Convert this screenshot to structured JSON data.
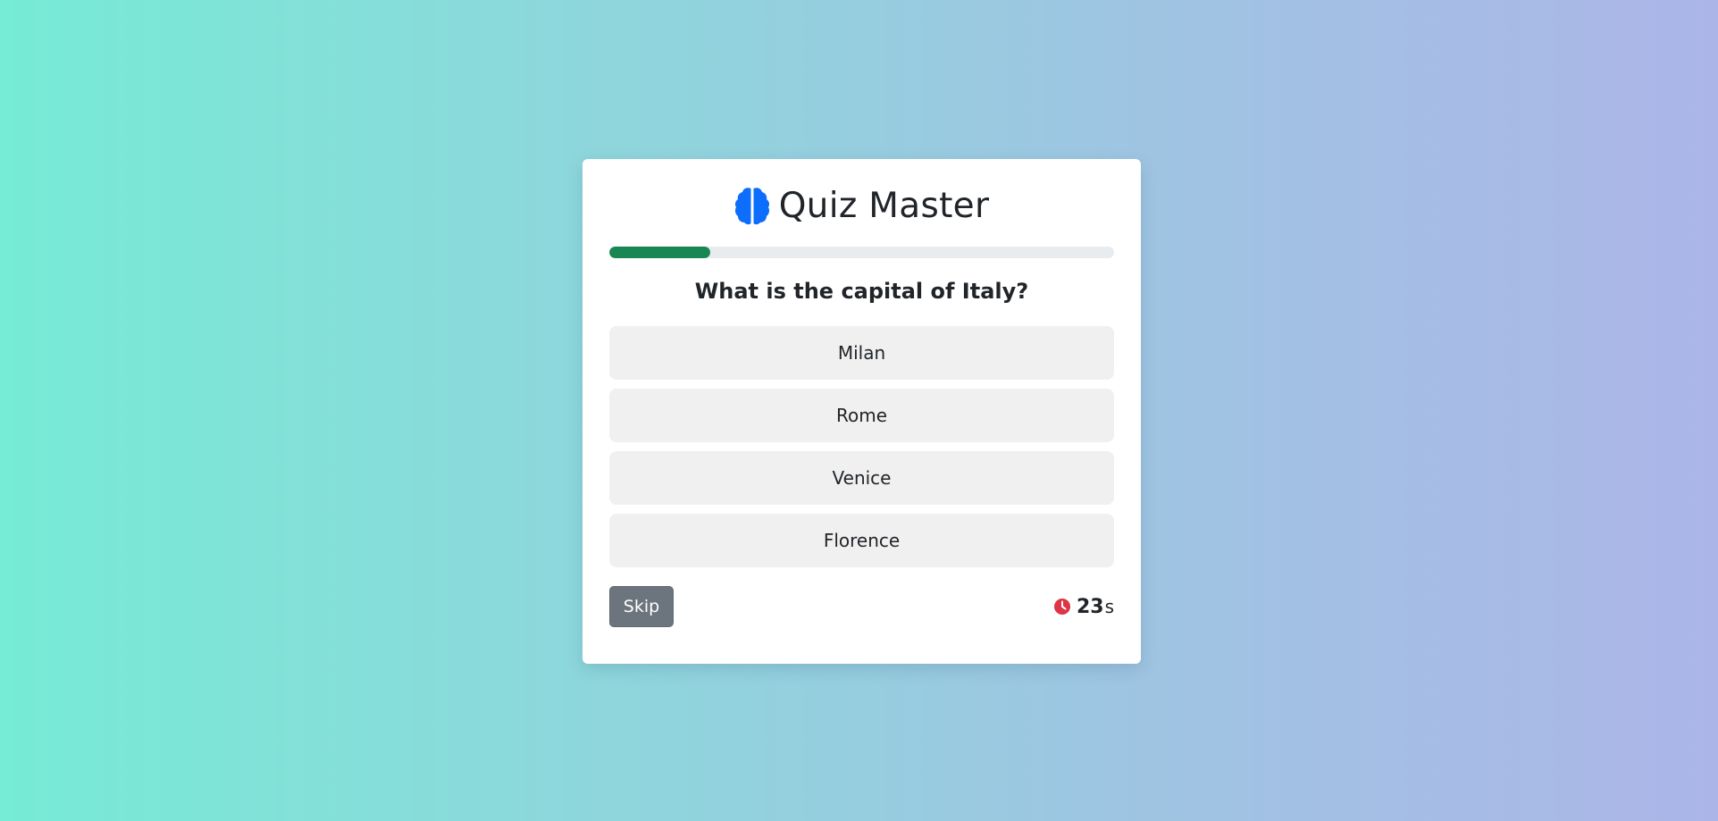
{
  "app": {
    "title": "Quiz Master",
    "icon": "brain-icon"
  },
  "progress": {
    "fraction": 0.2
  },
  "question": {
    "text": "What is the capital of Italy?"
  },
  "options": [
    {
      "label": "Milan"
    },
    {
      "label": "Rome"
    },
    {
      "label": "Venice"
    },
    {
      "label": "Florence"
    }
  ],
  "footer": {
    "skip_label": "Skip",
    "timer_icon": "clock-icon",
    "timer_value": "23",
    "timer_unit": "s"
  },
  "colors": {
    "brand": "#0d6efd",
    "progress": "#198754",
    "timer_icon": "#dc3545",
    "skip_bg": "#6c757d"
  }
}
